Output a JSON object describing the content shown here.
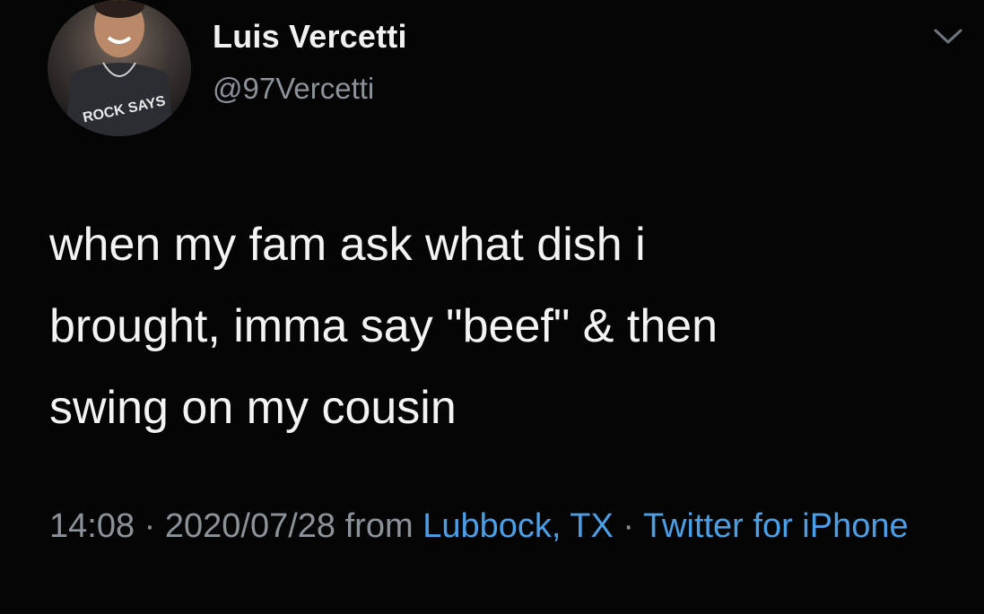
{
  "author": {
    "display_name": "Luis Vercetti",
    "handle": "@97Vercetti",
    "avatar_shirt_text": "ROCK SAYS"
  },
  "tweet": {
    "text": "when my fam ask what dish i\nbrought, imma say \"beef\" & then\nswing on my cousin"
  },
  "meta": {
    "time": "14:08",
    "separator": " · ",
    "date": "2020/07/28",
    "from_label": " from ",
    "location": "Lubbock, TX",
    "source": "Twitter for iPhone"
  },
  "icons": {
    "menu": "chevron-down-icon"
  },
  "colors": {
    "background": "#050505",
    "text": "#f3f3f3",
    "secondary": "#8b9299",
    "link": "#4a9fe6"
  }
}
